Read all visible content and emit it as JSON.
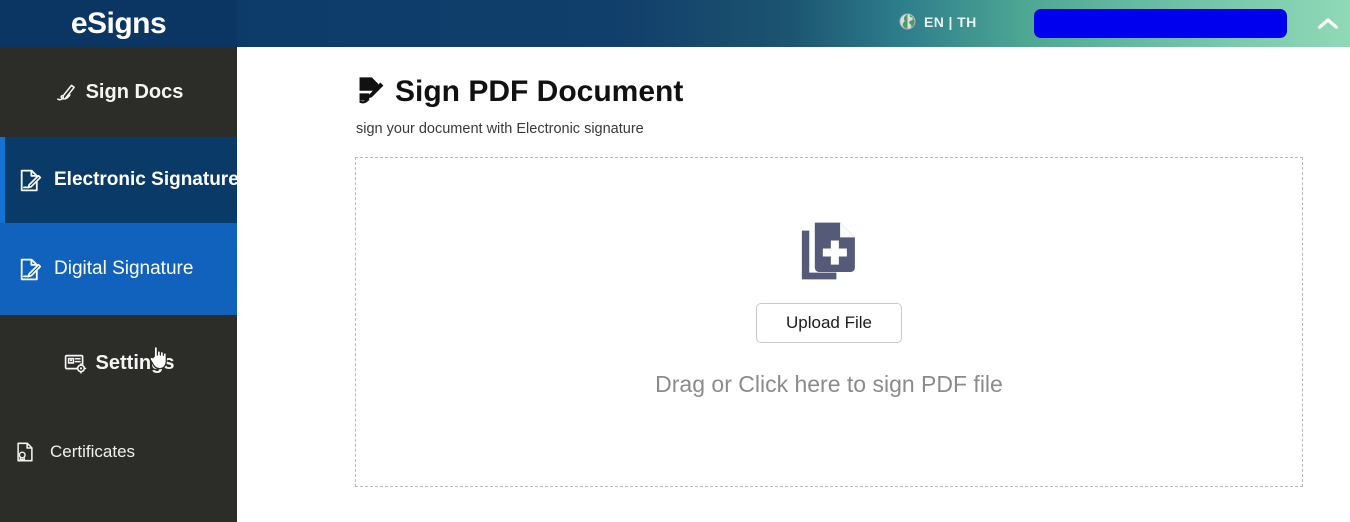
{
  "header": {
    "brand": "eSigns",
    "globe_icon": "globe-icon",
    "language": "EN | TH",
    "action_pill_label": "",
    "collapse_icon": "chevron-up-icon"
  },
  "sidebar": {
    "items": [
      {
        "id": "sign-docs",
        "label": "Sign Docs",
        "icon": "pen-signature-icon"
      },
      {
        "id": "electronic-signature",
        "label": "Electronic Signature",
        "icon": "document-pen-icon"
      },
      {
        "id": "digital-signature",
        "label": "Digital Signature",
        "icon": "document-pen-icon"
      },
      {
        "id": "settings",
        "label": "Settings",
        "icon": "id-card-gear-icon"
      },
      {
        "id": "certificates",
        "label": "Certificates",
        "icon": "certificate-award-icon"
      }
    ]
  },
  "main": {
    "title": "Sign PDF Document",
    "title_icon": "sign-document-icon",
    "subtitle": "sign your document with Electronic signature",
    "dropzone": {
      "icon": "add-file-icon",
      "upload_button": "Upload File",
      "hint": "Drag or Click here to sign PDF file"
    }
  },
  "colors": {
    "brand_navy": "#0b3562",
    "header_gradient_end": "#8fd9b6",
    "sidebar_bg": "#2c2c29",
    "item_active_dark": "#0a3a68",
    "item_active_bright": "#1162bd",
    "active_border": "#1372d4",
    "pill_blue": "#0000ee",
    "dropzone_icon": "#555a79",
    "hint_text": "#8b8b8b"
  }
}
